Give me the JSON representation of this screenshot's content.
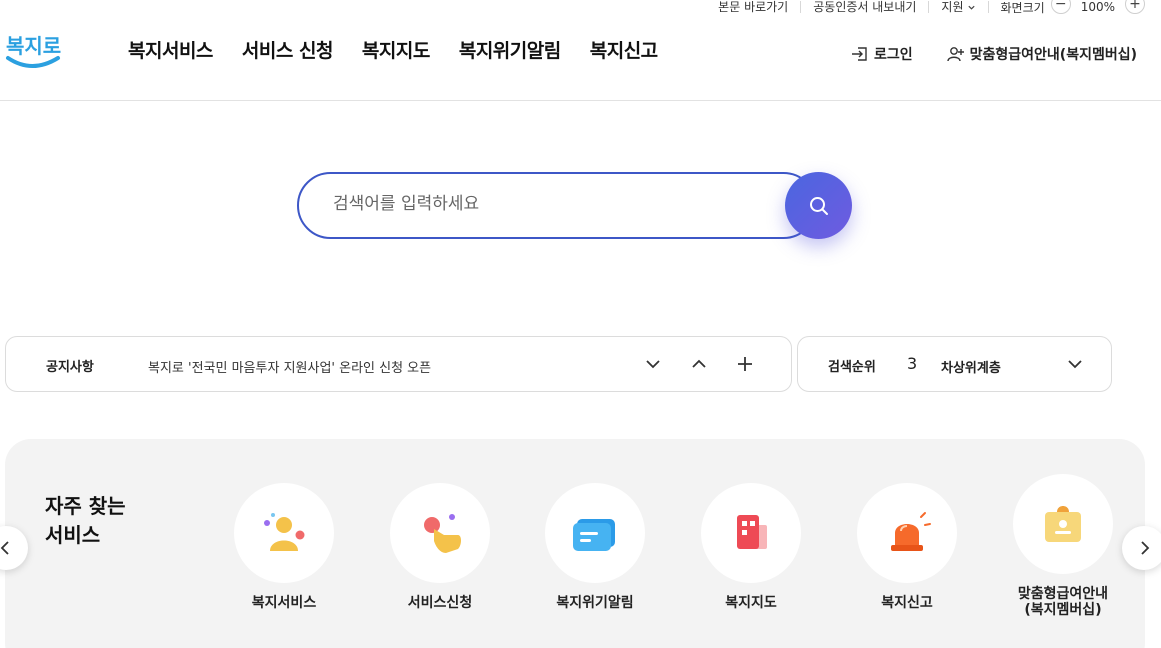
{
  "utility": {
    "skip_link": "본문 바로가기",
    "cert_export": "공동인증서 내보내기",
    "support": "지원",
    "zoom_label": "화면크기",
    "zoom_value": "100%",
    "zoom_out": "−",
    "zoom_in": "+"
  },
  "header": {
    "logo_text": "복지로",
    "nav": [
      "복지서비스",
      "서비스 신청",
      "복지지도",
      "복지위기알림",
      "복지신고"
    ],
    "login": "로그인",
    "membership": "맞춤형급여안내(복지멤버십)"
  },
  "search": {
    "placeholder": "검색어를 입력하세요"
  },
  "notice": {
    "label": "공지사항",
    "text": "복지로 '전국민 마음투자 지원사업' 온라인 신청 오픈"
  },
  "rank": {
    "label": "검색순위",
    "number": "3",
    "keyword": "차상위계층"
  },
  "frequent": {
    "title_line1": "자주 찾는",
    "title_line2": "서비스",
    "services": [
      {
        "label": "복지서비스",
        "icon": "person-icon"
      },
      {
        "label": "서비스신청",
        "icon": "hand-tap-icon"
      },
      {
        "label": "복지위기알림",
        "icon": "message-icon"
      },
      {
        "label": "복지지도",
        "icon": "map-building-icon"
      },
      {
        "label": "복지신고",
        "icon": "siren-icon"
      },
      {
        "label_line1": "맞춤형급여안내",
        "label_line2": "(복지멤버십)",
        "icon": "membership-card-icon"
      }
    ]
  },
  "colors": {
    "accent": "#3d57c7",
    "search_button": "#5a60e0",
    "panel_bg": "#f3f3f3"
  }
}
